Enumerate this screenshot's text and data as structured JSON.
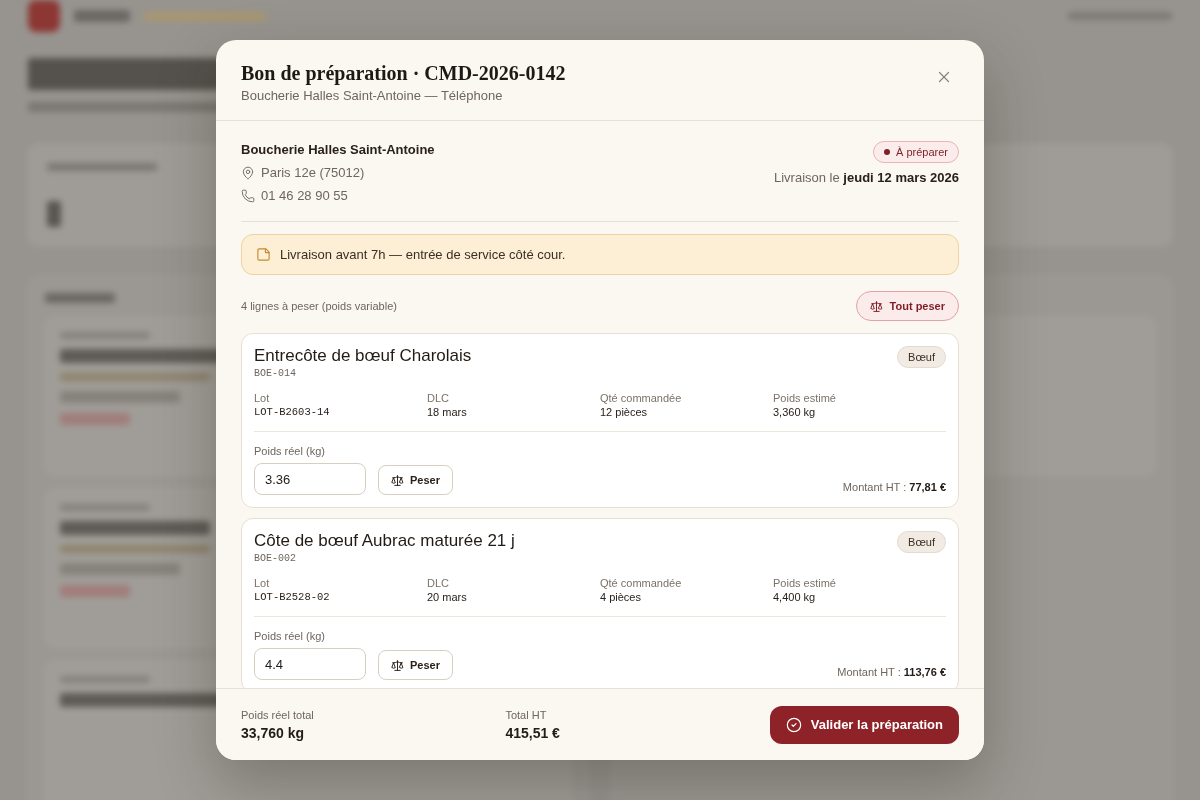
{
  "dialog": {
    "title": "Bon de préparation · CMD-2026-0142",
    "subtitle": "Boucherie Halles Saint-Antoine — Téléphone"
  },
  "customer": {
    "name": "Boucherie Halles Saint-Antoine",
    "location": "Paris 12e (75012)",
    "phone": "01 46 28 90 55",
    "status": "À préparer",
    "delivery": "Livraison le **jeudi 12 mars 2026**"
  },
  "note": "Livraison avant 7h — entrée de service côté cour.",
  "lines_summary": "4 lignes à peser (poids variable)",
  "weigh_all_button": "Tout peser",
  "items": [
    {
      "name": "Entrecôte de bœuf Charolais",
      "sku": "BOE-014",
      "category": "Bœuf",
      "fields": [
        {
          "kind": "code",
          "label": "Lot",
          "value": "LOT-B2603-14"
        },
        {
          "kind": "text",
          "label": "DLC",
          "value": "18 mars"
        },
        {
          "kind": "text",
          "label": "Qté commandée",
          "value": "12 pièces"
        },
        {
          "kind": "text",
          "label": "Poids estimé",
          "value": "3,360 kg"
        }
      ],
      "weight_label": "Poids réel (kg)",
      "weight_value": "3.36",
      "weigh_button": "Peser",
      "amount": "Montant HT : **77,81 €**"
    },
    {
      "name": "Côte de bœuf Aubrac maturée 21 j",
      "sku": "BOE-002",
      "category": "Bœuf",
      "fields": [
        {
          "kind": "code",
          "label": "Lot",
          "value": "LOT-B2528-02"
        },
        {
          "kind": "text",
          "label": "DLC",
          "value": "20 mars"
        },
        {
          "kind": "text",
          "label": "Qté commandée",
          "value": "4 pièces"
        },
        {
          "kind": "text",
          "label": "Poids estimé",
          "value": "4,400 kg"
        }
      ],
      "weight_label": "Poids réel (kg)",
      "weight_value": "4.4",
      "weigh_button": "Peser",
      "amount": "Montant HT : **113,76 €**"
    }
  ],
  "footer": {
    "totals": [
      {
        "label": "Poids réel total",
        "value": "33,760 kg"
      },
      {
        "label": "Total HT",
        "value": "415,51 €"
      }
    ],
    "validate_button": "Valider la préparation"
  }
}
